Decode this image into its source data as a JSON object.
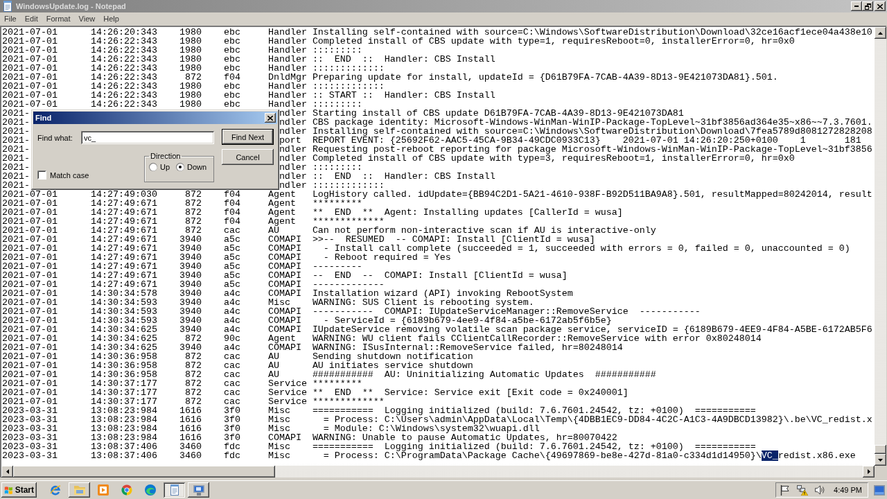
{
  "window": {
    "title": "WindowsUpdate.log - Notepad"
  },
  "menu": [
    "File",
    "Edit",
    "Format",
    "View",
    "Help"
  ],
  "log_rows": [
    {
      "kind": "entry",
      "date": "2021-07-01",
      "time": "14:26:20:343",
      "pid": "1980",
      "tid": "ebc",
      "category": "Handler",
      "message": "Installing self-contained with source=C:\\Windows\\SoftwareDistribution\\Download\\32ce16acf1ece04a438e10"
    },
    {
      "kind": "entry",
      "date": "2021-07-01",
      "time": "14:26:22:343",
      "pid": "1980",
      "tid": "ebc",
      "category": "Handler",
      "message": "Completed install of CBS update with type=1, requiresReboot=0, installerError=0, hr=0x0"
    },
    {
      "kind": "entry",
      "date": "2021-07-01",
      "time": "14:26:22:343",
      "pid": "1980",
      "tid": "ebc",
      "category": "Handler",
      "message": ":::::::::"
    },
    {
      "kind": "entry",
      "date": "2021-07-01",
      "time": "14:26:22:343",
      "pid": "1980",
      "tid": "ebc",
      "category": "Handler",
      "message": "::  END  ::  Handler: CBS Install"
    },
    {
      "kind": "entry",
      "date": "2021-07-01",
      "time": "14:26:22:343",
      "pid": "1980",
      "tid": "ebc",
      "category": "Handler",
      "message": ":::::::::::::"
    },
    {
      "kind": "entry",
      "date": "2021-07-01",
      "time": "14:26:22:343",
      "pid": "872",
      "tid": "f04",
      "category": "DnldMgr",
      "message": "Preparing update for install, updateId = {D61B79FA-7CAB-4A39-8D13-9E421073DA81}.501."
    },
    {
      "kind": "entry",
      "date": "2021-07-01",
      "time": "14:26:22:343",
      "pid": "1980",
      "tid": "ebc",
      "category": "Handler",
      "message": ":::::::::::::"
    },
    {
      "kind": "entry",
      "date": "2021-07-01",
      "time": "14:26:22:343",
      "pid": "1980",
      "tid": "ebc",
      "category": "Handler",
      "message": ":: START ::  Handler: CBS Install"
    },
    {
      "kind": "entry",
      "date": "2021-07-01",
      "time": "14:26:22:343",
      "pid": "1980",
      "tid": "ebc",
      "category": "Handler",
      "message": ":::::::::"
    },
    {
      "kind": "covered",
      "date": "2021-",
      "category": "ndler",
      "message": "Starting install of CBS update D61B79FA-7CAB-4A39-8D13-9E421073DA81"
    },
    {
      "kind": "covered",
      "date": "2021-",
      "category": "ndler",
      "message": "CBS package identity: Microsoft-Windows-WinMan-WinIP-Package-TopLevel~31bf3856ad364e35~x86~~7.3.7601."
    },
    {
      "kind": "covered",
      "date": "2021-",
      "category": "ndler",
      "message": "Installing self-contained with source=C:\\Windows\\SoftwareDistribution\\Download\\7fea5789d8081272828208"
    },
    {
      "kind": "covered",
      "date": "2021-",
      "category": "port",
      "message": "REPORT EVENT: {25692F62-AAC5-45CA-9B34-49CDC0933C13}    2021-07-01 14:26:20:250+0100    1       181"
    },
    {
      "kind": "covered",
      "date": "2021-",
      "category": "ndler",
      "message": "Requesting post-reboot reporting for package Microsoft-Windows-WinMan-WinIP-Package-TopLevel~31bf3856"
    },
    {
      "kind": "covered",
      "date": "2021-",
      "category": "ndler",
      "message": "Completed install of CBS update with type=3, requiresReboot=1, installerError=0, hr=0x0"
    },
    {
      "kind": "covered",
      "date": "2021-",
      "category": "ndler",
      "message": ":::::::::"
    },
    {
      "kind": "covered",
      "date": "2021-",
      "category": "ndler",
      "message": "::  END  ::  Handler: CBS Install"
    },
    {
      "kind": "covered",
      "date": "2021-",
      "category": "ndler",
      "message": ":::::::::::::"
    },
    {
      "kind": "entry",
      "date": "2021-07-01",
      "time": "14:27:49:030",
      "pid": "872",
      "tid": "f04",
      "category": "Agent",
      "message": "LogHistory called. idUpdate={BB94C2D1-5A21-4610-938F-B92D511BA9A8}.501, resultMapped=80242014, result"
    },
    {
      "kind": "entry",
      "date": "2021-07-01",
      "time": "14:27:49:671",
      "pid": "872",
      "tid": "f04",
      "category": "Agent",
      "message": "*********"
    },
    {
      "kind": "entry",
      "date": "2021-07-01",
      "time": "14:27:49:671",
      "pid": "872",
      "tid": "f04",
      "category": "Agent",
      "message": "**  END  **  Agent: Installing updates [CallerId = wusa]"
    },
    {
      "kind": "entry",
      "date": "2021-07-01",
      "time": "14:27:49:671",
      "pid": "872",
      "tid": "f04",
      "category": "Agent",
      "message": "*************"
    },
    {
      "kind": "entry",
      "date": "2021-07-01",
      "time": "14:27:49:671",
      "pid": "872",
      "tid": "cac",
      "category": "AU",
      "message": "Can not perform non-interactive scan if AU is interactive-only"
    },
    {
      "kind": "entry",
      "date": "2021-07-01",
      "time": "14:27:49:671",
      "pid": "3940",
      "tid": "a5c",
      "category": "COMAPI",
      "message": ">>--  RESUMED  -- COMAPI: Install [ClientId = wusa]"
    },
    {
      "kind": "entry",
      "date": "2021-07-01",
      "time": "14:27:49:671",
      "pid": "3940",
      "tid": "a5c",
      "category": "COMAPI",
      "message": "  - Install call complete (succeeded = 1, succeeded with errors = 0, failed = 0, unaccounted = 0)"
    },
    {
      "kind": "entry",
      "date": "2021-07-01",
      "time": "14:27:49:671",
      "pid": "3940",
      "tid": "a5c",
      "category": "COMAPI",
      "message": "  - Reboot required = Yes"
    },
    {
      "kind": "entry",
      "date": "2021-07-01",
      "time": "14:27:49:671",
      "pid": "3940",
      "tid": "a5c",
      "category": "COMAPI",
      "message": "---------"
    },
    {
      "kind": "entry",
      "date": "2021-07-01",
      "time": "14:27:49:671",
      "pid": "3940",
      "tid": "a5c",
      "category": "COMAPI",
      "message": "--  END  --  COMAPI: Install [ClientId = wusa]"
    },
    {
      "kind": "entry",
      "date": "2021-07-01",
      "time": "14:27:49:671",
      "pid": "3940",
      "tid": "a5c",
      "category": "COMAPI",
      "message": "-------------"
    },
    {
      "kind": "entry",
      "date": "2021-07-01",
      "time": "14:30:34:578",
      "pid": "3940",
      "tid": "a4c",
      "category": "COMAPI",
      "message": "Installation wizard (API) invoking RebootSystem"
    },
    {
      "kind": "entry",
      "date": "2021-07-01",
      "time": "14:30:34:593",
      "pid": "3940",
      "tid": "a4c",
      "category": "Misc",
      "message": "WARNING: SUS Client is rebooting system."
    },
    {
      "kind": "entry",
      "date": "2021-07-01",
      "time": "14:30:34:593",
      "pid": "3940",
      "tid": "a4c",
      "category": "COMAPI",
      "message": "-----------  COMAPI: IUpdateServiceManager::RemoveService  -----------"
    },
    {
      "kind": "entry",
      "date": "2021-07-01",
      "time": "14:30:34:593",
      "pid": "3940",
      "tid": "a4c",
      "category": "COMAPI",
      "message": "  - ServiceId = {6189b679-4ee9-4f84-a5be-6172ab5f6b5e}"
    },
    {
      "kind": "entry",
      "date": "2021-07-01",
      "time": "14:30:34:625",
      "pid": "3940",
      "tid": "a4c",
      "category": "COMAPI",
      "message": "IUpdateService removing volatile scan package service, serviceID = {6189B679-4EE9-4F84-A5BE-6172AB5F6"
    },
    {
      "kind": "entry",
      "date": "2021-07-01",
      "time": "14:30:34:625",
      "pid": "872",
      "tid": "90c",
      "category": "Agent",
      "message": "WARNING: WU client fails CClientCallRecorder::RemoveService with error 0x80248014"
    },
    {
      "kind": "entry",
      "date": "2021-07-01",
      "time": "14:30:34:625",
      "pid": "3940",
      "tid": "a4c",
      "category": "COMAPI",
      "message": "WARNING: ISusInternal::RemoveService failed, hr=80248014"
    },
    {
      "kind": "entry",
      "date": "2021-07-01",
      "time": "14:30:36:958",
      "pid": "872",
      "tid": "cac",
      "category": "AU",
      "message": "Sending shutdown notification"
    },
    {
      "kind": "entry",
      "date": "2021-07-01",
      "time": "14:30:36:958",
      "pid": "872",
      "tid": "cac",
      "category": "AU",
      "message": "AU initiates service shutdown"
    },
    {
      "kind": "entry",
      "date": "2021-07-01",
      "time": "14:30:36:958",
      "pid": "872",
      "tid": "cac",
      "category": "AU",
      "message": "###########  AU: Uninitializing Automatic Updates  ###########"
    },
    {
      "kind": "entry",
      "date": "2021-07-01",
      "time": "14:30:37:177",
      "pid": "872",
      "tid": "cac",
      "category": "Service",
      "message": "*********"
    },
    {
      "kind": "entry",
      "date": "2021-07-01",
      "time": "14:30:37:177",
      "pid": "872",
      "tid": "cac",
      "category": "Service",
      "message": "**  END  **  Service: Service exit [Exit code = 0x240001]"
    },
    {
      "kind": "entry",
      "date": "2021-07-01",
      "time": "14:30:37:177",
      "pid": "872",
      "tid": "cac",
      "category": "Service",
      "message": "*************"
    },
    {
      "kind": "entry",
      "date": "2023-03-31",
      "time": "13:08:23:984",
      "pid": "1616",
      "tid": "3f0",
      "category": "Misc",
      "message": "===========  Logging initialized (build: 7.6.7601.24542, tz: +0100)  ==========="
    },
    {
      "kind": "entry",
      "date": "2023-03-31",
      "time": "13:08:23:984",
      "pid": "1616",
      "tid": "3f0",
      "category": "Misc",
      "message": "  = Process: C:\\Users\\admin\\AppData\\Local\\Temp\\{4DBB1EC9-DD84-4C2C-A1C3-4A9DBCD13982}\\.be\\VC_redist.x"
    },
    {
      "kind": "entry",
      "date": "2023-03-31",
      "time": "13:08:23:984",
      "pid": "1616",
      "tid": "3f0",
      "category": "Misc",
      "message": "  = Module: C:\\Windows\\system32\\wuapi.dll"
    },
    {
      "kind": "entry",
      "date": "2023-03-31",
      "time": "13:08:23:984",
      "pid": "1616",
      "tid": "3f0",
      "category": "COMAPI",
      "message": "WARNING: Unable to pause Automatic Updates, hr=80070422"
    },
    {
      "kind": "entry",
      "date": "2023-03-31",
      "time": "13:08:37:406",
      "pid": "3460",
      "tid": "fdc",
      "category": "Misc",
      "message": "===========  Logging initialized (build: 7.6.7601.24542, tz: +0100)  ==========="
    },
    {
      "kind": "entry",
      "date": "2023-03-31",
      "time": "13:08:37:406",
      "pid": "3460",
      "tid": "fdc",
      "category": "Misc",
      "message": "  = Process: C:\\ProgramData\\Package Cache\\{49697869-be8e-427d-81a0-c334d1d14950}\\",
      "highlight": "VC_",
      "message_end": "redist.x86.exe"
    }
  ],
  "find_dialog": {
    "title": "Find",
    "find_what": {
      "label": "Find what:",
      "value": "vc_"
    },
    "match_case": {
      "label": "Match case",
      "checked": false
    },
    "direction": {
      "label": "Direction",
      "options": [
        {
          "label": "Up",
          "selected": false
        },
        {
          "label": "Down",
          "selected": true
        }
      ]
    },
    "buttons": [
      {
        "label": "Find Next",
        "default": true
      },
      {
        "label": "Cancel",
        "default": false
      }
    ]
  },
  "taskbar": {
    "start_label": "Start",
    "items": [
      {
        "kind": "launcher"
      },
      {
        "kind": "task",
        "selected": false
      },
      {
        "kind": "launcher"
      },
      {
        "kind": "launcher"
      },
      {
        "kind": "launcher"
      },
      {
        "kind": "task",
        "selected": true
      },
      {
        "kind": "task",
        "selected": false
      }
    ],
    "clock": "4:49 PM"
  }
}
